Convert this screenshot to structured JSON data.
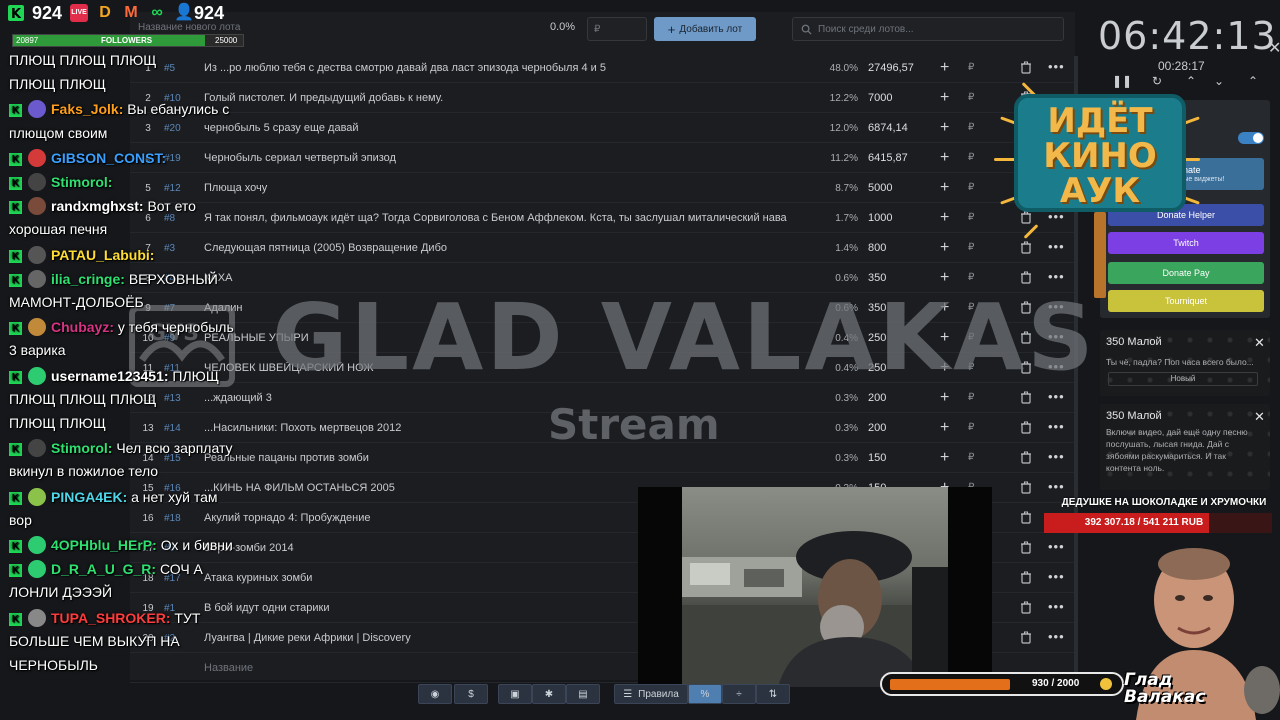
{
  "stats": {
    "viewers": "924",
    "live_badge": "LIVE",
    "viewers_total": "924",
    "followers_label": "FOLLOWERS",
    "followers_current": "20897",
    "followers_goal": "25000",
    "followers_progress": 0.8359
  },
  "auction": {
    "new_lot_label": "Название нового лота",
    "percent_total": "0.0%",
    "amount_placeholder": "₽",
    "add_lot_label": "Добавить лот",
    "search_placeholder": "Поиск среди лотов...",
    "bottom_placeholder": "Название",
    "lots": [
      {
        "rank": "1",
        "id": "#5",
        "name": "Из ...ро люблю тебя с дества смотрю давай два ласт эпизода чернобыля 4 и 5",
        "pct": "48.0%",
        "amount": "27496,57"
      },
      {
        "rank": "2",
        "id": "#10",
        "name": "Голый пистолет. И предыдущий добавь к нему.",
        "pct": "12.2%",
        "amount": "7000"
      },
      {
        "rank": "3",
        "id": "#20",
        "name": "чернобыль 5 сразу еще давай",
        "pct": "12.0%",
        "amount": "6874,14"
      },
      {
        "rank": "4",
        "id": "#19",
        "name": "Чернобыль сериал четвертый эпизод",
        "pct": "11.2%",
        "amount": "6415,87"
      },
      {
        "rank": "5",
        "id": "#12",
        "name": "Плюща хочу",
        "pct": "8.7%",
        "amount": "5000"
      },
      {
        "rank": "6",
        "id": "#8",
        "name": "Я так понял, фильмоаук идёт ща? Тогда Сорвиголова с Беном Аффлеком. Кста, ты заслушал миталический нава",
        "pct": "1.7%",
        "amount": "1000"
      },
      {
        "rank": "7",
        "id": "#3",
        "name": "Следующая пятница (2005) Возвращение Дибо",
        "pct": "1.4%",
        "amount": "800"
      },
      {
        "rank": "8",
        "id": "#4",
        "name": "КАХА",
        "pct": "0.6%",
        "amount": "350"
      },
      {
        "rank": "9",
        "id": "#7",
        "name": "Адалин",
        "pct": "0.6%",
        "amount": "350"
      },
      {
        "rank": "10",
        "id": "#9",
        "name": "РЕАЛЬНЫЕ УПЫРИ",
        "pct": "0.4%",
        "amount": "250"
      },
      {
        "rank": "11",
        "id": "#11",
        "name": "ЧЕЛОВЕК ШВЕЙЦАРСКИЙ НОЖ",
        "pct": "0.4%",
        "amount": "250"
      },
      {
        "rank": "12",
        "id": "#13",
        "name": "...ждающий 3",
        "pct": "0.3%",
        "amount": "200"
      },
      {
        "rank": "13",
        "id": "#14",
        "name": "...Насильники: Похоть мертвецов 2012",
        "pct": "0.3%",
        "amount": "200"
      },
      {
        "rank": "14",
        "id": "#15",
        "name": "Реальные пацаны против зомби",
        "pct": "0.3%",
        "amount": "150"
      },
      {
        "rank": "15",
        "id": "#16",
        "name": "...КИНЬ НА ФИЛЬМ ОСТАНЬСЯ 2005",
        "pct": "0.3%",
        "amount": "150"
      },
      {
        "rank": "16",
        "id": "#18",
        "name": "Акулий торнадо 4: Пробуждение",
        "pct": "",
        "amount": ""
      },
      {
        "rank": "17",
        "id": "#6",
        "name": "Воры-зомби 2014",
        "pct": "",
        "amount": ""
      },
      {
        "rank": "18",
        "id": "#17",
        "name": "Атака куриных зомби",
        "pct": "",
        "amount": ""
      },
      {
        "rank": "19",
        "id": "#1",
        "name": "В бой идут одни старики",
        "pct": "",
        "amount": ""
      },
      {
        "rank": "20",
        "id": "#2",
        "name": "Луангва | Дикие реки Африки | Discovery",
        "pct": "",
        "amount": ""
      }
    ]
  },
  "watermark": {
    "title": "GLAD VALAKAS",
    "subtitle": "Stream"
  },
  "chat": {
    "lines": [
      {
        "text": "ПЛЮЩ    ПЛЮЩ    ПЛЮЩ"
      },
      {
        "text": "ПЛЮЩ    ПЛЮЩ"
      },
      {
        "nick": "Faks_Jolk:",
        "color": "#ff9f1c",
        "avatar": "#6a5acd",
        "msg": "Вы ебанулись с"
      },
      {
        "text": "плющом своим"
      },
      {
        "nick": "GIBSON_CONST:",
        "color": "#3aa0ff",
        "avatar": "#d43a3a",
        "msg": ""
      },
      {
        "nick": "Stimorol:",
        "color": "#2fe071",
        "avatar": "#444444",
        "msg": ""
      },
      {
        "nick": "randxmghxst:",
        "color": "#ffffff",
        "avatar": "#7a4a3a",
        "msg": "Вот ето"
      },
      {
        "text": "хорошая печня"
      },
      {
        "nick": "PATAU_Labubi:",
        "color": "#ffdd33",
        "avatar": "#555555",
        "msg": ""
      },
      {
        "nick": "ilia_cringe:",
        "color": "#2fe071",
        "avatar": "#666666",
        "msg": "ВЕРХОВНЫЙ"
      },
      {
        "text": "МАМОНТ-ДОЛБОЁБ"
      },
      {
        "nick": "Chubayz:",
        "color": "#d63384",
        "avatar": "#c08a3a",
        "msg": "у тебя чернобыль"
      },
      {
        "text": "3 варика"
      },
      {
        "nick": "username123451:",
        "color": "#ffffff",
        "avatar": "#2ecc71",
        "msg": "ПЛЮЩ"
      },
      {
        "text": "ПЛЮЩ    ПЛЮЩ    ПЛЮЩ"
      },
      {
        "text": "ПЛЮЩ    ПЛЮЩ"
      },
      {
        "nick": "Stimorol:",
        "color": "#2fe071",
        "avatar": "#444444",
        "msg": "Чел всю зарплату"
      },
      {
        "text": "вкинул в пожилое тело"
      },
      {
        "nick": "PINGA4EK:",
        "color": "#4fd6e8",
        "avatar": "#8bc34a",
        "msg": "а нет хуй там"
      },
      {
        "text": "вор"
      },
      {
        "nick": "4OPHblu_HErP:",
        "color": "#2fe071",
        "avatar": "#2ecc71",
        "msg": "Ох и бивни"
      },
      {
        "nick": "D_R_A_U_G_R:",
        "color": "#2fe071",
        "avatar": "#2ecc71",
        "msg": "СОЧ А"
      },
      {
        "text": "ЛОНЛИ ДЭЭЭЙ"
      },
      {
        "nick": "TUPA_SHROKER:",
        "color": "#ff3b3b",
        "avatar": "#888888",
        "msg": "ТУТ"
      },
      {
        "text": "БОЛЬШЕ ЧЕМ ВЫКУП НА"
      },
      {
        "text": "ЧЕРНОБЫЛЬ"
      }
    ]
  },
  "right": {
    "clock": "06:42:13",
    "timer": "00:28:17",
    "kino_sign": "ИДЁТ\nКИНО\nАУК",
    "donate_buttons": [
      {
        "label": "Donate",
        "sub": "...уникальные виджеты!",
        "color": "#3a6f9a"
      },
      {
        "label": "Donate Helper",
        "color": "#3b4fa8"
      },
      {
        "label": "Twitch",
        "color": "#7b3fe4"
      },
      {
        "label": "Donate Pay",
        "color": "#3aa55c"
      },
      {
        "label": "Tourniquet",
        "color": "#c9c23b"
      }
    ],
    "donations": [
      {
        "name": "350 Малой",
        "msg": "Ты чё, падла? Поп часа всего было...",
        "select": "Новый"
      },
      {
        "name": "350 Малой",
        "msg": "Включи видео, дай ещё одну песню послушать, лысая гнида. Дай с зябоями раскумариться. И так контента ноль."
      }
    ],
    "goal": {
      "title": "ДЕДУШКЕ НА ШОКОЛАДКЕ И ХРУМОЧКИ",
      "value": "392 307.18 / 541 211 RUB",
      "progress": 0.7249
    },
    "follow_goal": {
      "value": "930 / 2000"
    },
    "brand": "Глад\nВалакас"
  },
  "bottom_toolbar": {
    "rules_label": "Правила",
    "percent_label": "%"
  },
  "colors": {
    "accent": "#6f9ac7",
    "bg": "#1b1d21",
    "kino_board": "#1b7d8c",
    "kino_text": "#f2b84a",
    "goal_fill": "#c91d1d"
  }
}
